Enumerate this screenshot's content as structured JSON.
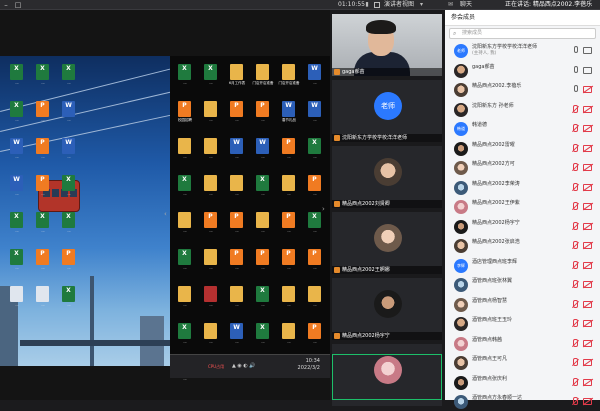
{
  "topbar": {
    "timer": "01:10:55",
    "recording": "录制",
    "view_toggle": "演讲者视图",
    "chat": "聊天",
    "status": "正在讲话: 精品西点2002.李蓓乐"
  },
  "desktop": {
    "cpu_label": "CPU占用",
    "clock_time": "10:34",
    "clock_date": "2022/3/2",
    "files_left": [
      {
        "type": "x",
        "name": "..."
      },
      {
        "type": "x",
        "name": "..."
      },
      {
        "type": "x",
        "name": "..."
      },
      {
        "type": "x",
        "name": "..."
      },
      {
        "type": "p",
        "name": "..."
      },
      {
        "type": "w",
        "name": "..."
      },
      {
        "type": "w",
        "name": "..."
      },
      {
        "type": "p",
        "name": "..."
      },
      {
        "type": "w",
        "name": "..."
      },
      {
        "type": "w",
        "name": "..."
      },
      {
        "type": "p",
        "name": "..."
      },
      {
        "type": "x",
        "name": "..."
      },
      {
        "type": "x",
        "name": "..."
      },
      {
        "type": "x",
        "name": "..."
      },
      {
        "type": "x",
        "name": "..."
      },
      {
        "type": "x",
        "name": "..."
      },
      {
        "type": "p",
        "name": "..."
      },
      {
        "type": "p",
        "name": "..."
      },
      {
        "type": "d",
        "name": "..."
      },
      {
        "type": "d",
        "name": "..."
      },
      {
        "type": "x",
        "name": "..."
      }
    ],
    "files_right": [
      {
        "type": "x",
        "name": "..."
      },
      {
        "type": "x",
        "name": "..."
      },
      {
        "type": "f",
        "name": "6月工作表"
      },
      {
        "type": "f",
        "name": "门店开店准备"
      },
      {
        "type": "f",
        "name": "门店开店准备"
      },
      {
        "type": "w",
        "name": "..."
      },
      {
        "type": "p",
        "name": "校园招聘"
      },
      {
        "type": "f",
        "name": "..."
      },
      {
        "type": "p",
        "name": "..."
      },
      {
        "type": "p",
        "name": "..."
      },
      {
        "type": "w",
        "name": "春节礼品"
      },
      {
        "type": "w",
        "name": "..."
      },
      {
        "type": "f",
        "name": "..."
      },
      {
        "type": "f",
        "name": "..."
      },
      {
        "type": "w",
        "name": "..."
      },
      {
        "type": "w",
        "name": "..."
      },
      {
        "type": "p",
        "name": "..."
      },
      {
        "type": "x",
        "name": "..."
      },
      {
        "type": "x",
        "name": "..."
      },
      {
        "type": "f",
        "name": "..."
      },
      {
        "type": "f",
        "name": "..."
      },
      {
        "type": "x",
        "name": "..."
      },
      {
        "type": "f",
        "name": "..."
      },
      {
        "type": "p",
        "name": "..."
      },
      {
        "type": "f",
        "name": "..."
      },
      {
        "type": "p",
        "name": "..."
      },
      {
        "type": "p",
        "name": "..."
      },
      {
        "type": "f",
        "name": "..."
      },
      {
        "type": "p",
        "name": "..."
      },
      {
        "type": "x",
        "name": "..."
      },
      {
        "type": "x",
        "name": "..."
      },
      {
        "type": "f",
        "name": "..."
      },
      {
        "type": "p",
        "name": "..."
      },
      {
        "type": "p",
        "name": "..."
      },
      {
        "type": "p",
        "name": "..."
      },
      {
        "type": "p",
        "name": "..."
      },
      {
        "type": "f",
        "name": "..."
      },
      {
        "type": "r",
        "name": "..."
      },
      {
        "type": "f",
        "name": "..."
      },
      {
        "type": "x",
        "name": "..."
      },
      {
        "type": "f",
        "name": "..."
      },
      {
        "type": "f",
        "name": "..."
      },
      {
        "type": "x",
        "name": "..."
      },
      {
        "type": "f",
        "name": "..."
      },
      {
        "type": "w",
        "name": "..."
      },
      {
        "type": "x",
        "name": "..."
      },
      {
        "type": "f",
        "name": "..."
      },
      {
        "type": "p",
        "name": "..."
      },
      {
        "type": "x",
        "name": "..."
      }
    ]
  },
  "videos": [
    {
      "name": "gaga郝苗",
      "kind": "camera"
    },
    {
      "name": "沈阳新东方学校学校洋洋老师",
      "kind": "badge",
      "badge": "老师"
    },
    {
      "name": "精品西点2002刘贤卿",
      "kind": "avatar",
      "avatar": "ava-photo2"
    },
    {
      "name": "精品西点2002王婀娜",
      "kind": "avatar",
      "avatar": "ava-photo4"
    },
    {
      "name": "精品西点2002杨宇宁",
      "kind": "avatar",
      "avatar": "ava-photo3"
    },
    {
      "name": "",
      "kind": "avatar",
      "avatar": "ava-photo6"
    }
  ],
  "panel": {
    "title": "参会成员",
    "search_placeholder": "搜索成员",
    "members": [
      {
        "name": "沈阳新东方学校学校洋洋老师",
        "sub": "(主持人, 我)",
        "avatar": "ava-blue",
        "avatar_text": "老师",
        "mic": "on",
        "cam": "on"
      },
      {
        "name": "gaga郝苗",
        "sub": "",
        "avatar": "ava-photo1",
        "avatar_text": "",
        "mic": "on",
        "cam": "on"
      },
      {
        "name": "精品西点2002.李蓓乐",
        "sub": "",
        "avatar": "ava-photo2",
        "avatar_text": "",
        "mic": "on",
        "cam": "off"
      },
      {
        "name": "沈阳新东方 孙老师",
        "sub": "",
        "avatar": "ava-photo1",
        "avatar_text": "",
        "mic": "off",
        "cam": "off"
      },
      {
        "name": "韩道德",
        "sub": "",
        "avatar": "ava-blue",
        "avatar_text": "韩道",
        "mic": "off",
        "cam": "off"
      },
      {
        "name": "精品西点2002雷曜",
        "sub": "",
        "avatar": "ava-photo3",
        "avatar_text": "",
        "mic": "off",
        "cam": "off"
      },
      {
        "name": "精品西点2002方可",
        "sub": "",
        "avatar": "ava-photo4",
        "avatar_text": "",
        "mic": "off",
        "cam": "off"
      },
      {
        "name": "精品西点2002李荣涛",
        "sub": "",
        "avatar": "ava-photo5",
        "avatar_text": "",
        "mic": "off",
        "cam": "off"
      },
      {
        "name": "精品西点2002王伊紫",
        "sub": "",
        "avatar": "ava-photo6",
        "avatar_text": "",
        "mic": "off",
        "cam": "off"
      },
      {
        "name": "精品西点2002杨宇宁",
        "sub": "",
        "avatar": "ava-photo3",
        "avatar_text": "",
        "mic": "off",
        "cam": "off"
      },
      {
        "name": "精品西点2002张启浩",
        "sub": "",
        "avatar": "ava-photo2",
        "avatar_text": "",
        "mic": "off",
        "cam": "off"
      },
      {
        "name": "酒店管理西点班李辉",
        "sub": "",
        "avatar": "ava-blue",
        "avatar_text": "李辉",
        "mic": "off",
        "cam": "off"
      },
      {
        "name": "酒管西点班张林翼",
        "sub": "",
        "avatar": "ava-photo5",
        "avatar_text": "",
        "mic": "off",
        "cam": "off"
      },
      {
        "name": "酒管西点杨智慧",
        "sub": "",
        "avatar": "ava-photo4",
        "avatar_text": "",
        "mic": "off",
        "cam": "off"
      },
      {
        "name": "酒管西点班王玉玲",
        "sub": "",
        "avatar": "ava-photo1",
        "avatar_text": "",
        "mic": "off",
        "cam": "off"
      },
      {
        "name": "酒管西点韩茜",
        "sub": "",
        "avatar": "ava-photo6",
        "avatar_text": "",
        "mic": "off",
        "cam": "off"
      },
      {
        "name": "酒管西点王可凡",
        "sub": "",
        "avatar": "ava-photo2",
        "avatar_text": "",
        "mic": "off",
        "cam": "off"
      },
      {
        "name": "酒管西点张庆利",
        "sub": "",
        "avatar": "ava-photo3",
        "avatar_text": "",
        "mic": "off",
        "cam": "off"
      },
      {
        "name": "酒管西点方永春顺一达",
        "sub": "",
        "avatar": "ava-photo5",
        "avatar_text": "",
        "mic": "off",
        "cam": "off"
      }
    ]
  }
}
